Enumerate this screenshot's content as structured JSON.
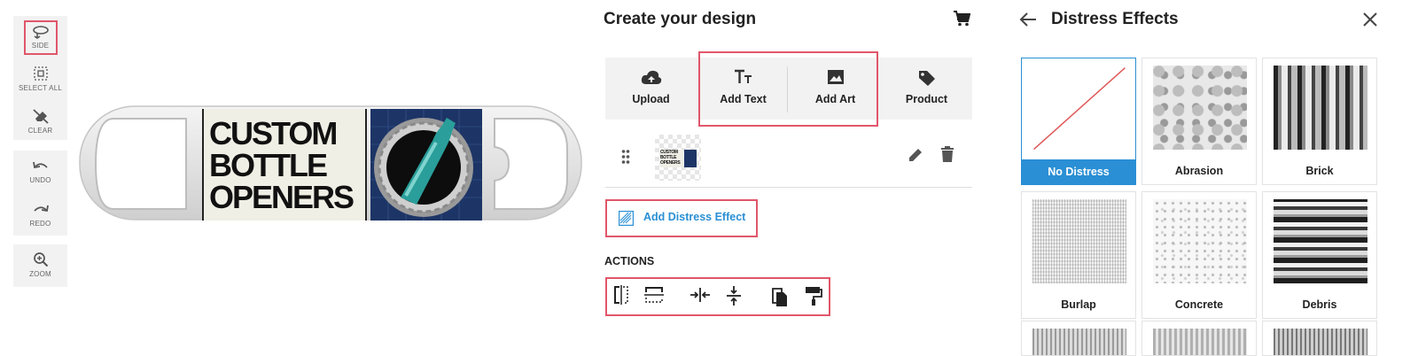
{
  "toolbar": {
    "side": "SIDE",
    "select_all": "SELECT ALL",
    "clear": "CLEAR",
    "undo": "UNDO",
    "redo": "REDO",
    "zoom": "ZOOM"
  },
  "canvas": {
    "logo_lines": [
      "CUSTOM",
      "BOTTLE",
      "OPENERS"
    ],
    "thumb_lines": [
      "CUSTOM",
      "BOTTLE",
      "OPENERS"
    ]
  },
  "design_panel": {
    "title": "Create your design",
    "cart_icon": "cart-icon",
    "tabs": [
      {
        "label": "Upload",
        "icon": "cloud-upload-icon"
      },
      {
        "label": "Add Text",
        "icon": "text-size-icon"
      },
      {
        "label": "Add Art",
        "icon": "image-icon"
      },
      {
        "label": "Product",
        "icon": "tag-icon"
      }
    ],
    "layer": {
      "drag_icon": "drag-handle-icon",
      "edit_icon": "pencil-icon",
      "delete_icon": "trash-icon"
    },
    "distress_button": "Add Distress Effect",
    "actions_label": "ACTIONS",
    "actions": [
      "flip-horizontal-icon",
      "flip-vertical-icon",
      "center-horizontal-icon",
      "center-vertical-icon",
      "duplicate-icon",
      "paint-roller-icon"
    ]
  },
  "distress_panel": {
    "title": "Distress Effects",
    "effects": [
      {
        "name": "No Distress",
        "selected": true
      },
      {
        "name": "Abrasion",
        "selected": false
      },
      {
        "name": "Brick",
        "selected": false
      },
      {
        "name": "Burlap",
        "selected": false
      },
      {
        "name": "Concrete",
        "selected": false
      },
      {
        "name": "Debris",
        "selected": false
      }
    ]
  },
  "colors": {
    "accent": "#2a8fd4",
    "highlight": "#e0566a",
    "panel_bg": "#f2f2f2"
  }
}
